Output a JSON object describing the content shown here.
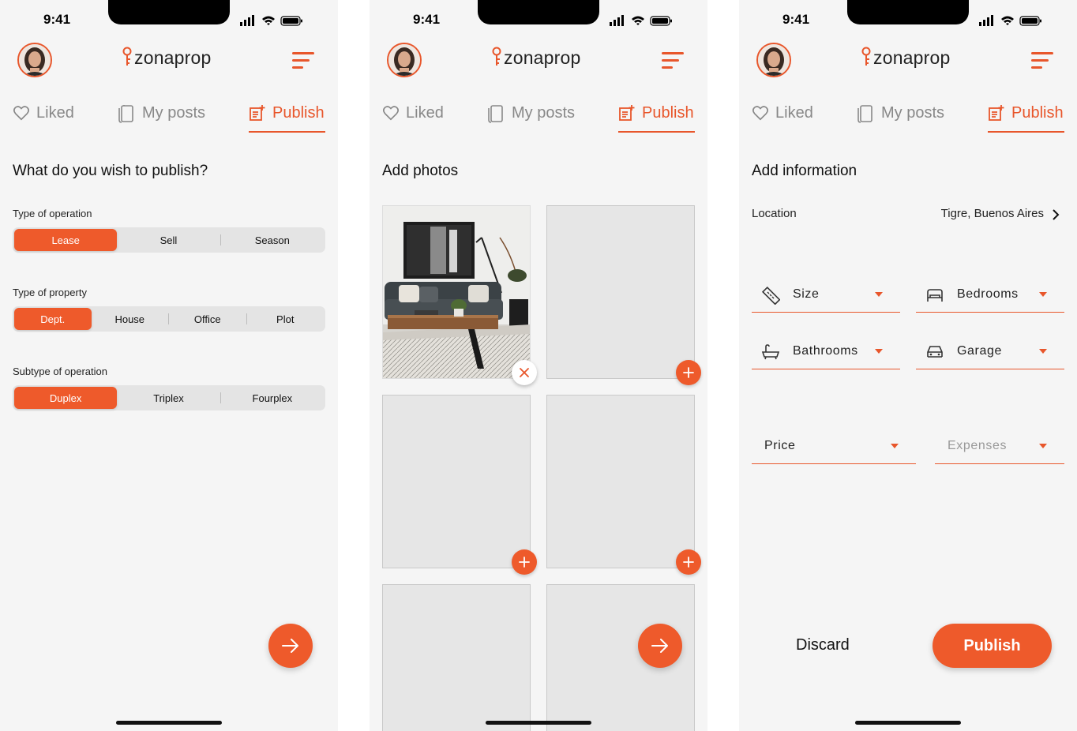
{
  "status": {
    "time": "9:41"
  },
  "app": {
    "brand": "zonaprop"
  },
  "tabs": {
    "liked": "Liked",
    "my_posts": "My posts",
    "publish": "Publish"
  },
  "colors": {
    "accent": "#ee5a2b",
    "background": "#f5f5f5",
    "segment_bg": "#e4e4e4"
  },
  "screen1": {
    "title": "What do you wish to publish?",
    "operation": {
      "label": "Type of operation",
      "options": [
        "Lease",
        "Sell",
        "Season"
      ],
      "selected": "Lease"
    },
    "property": {
      "label": "Type of property",
      "options": [
        "Dept.",
        "House",
        "Office",
        "Plot"
      ],
      "selected": "Dept."
    },
    "subtype": {
      "label": "Subtype of operation",
      "options": [
        "Duplex",
        "Triplex",
        "Fourplex"
      ],
      "selected": "Duplex"
    }
  },
  "screen2": {
    "title": "Add photos",
    "photo_slots": 6,
    "filled_slots": 1
  },
  "screen3": {
    "title": "Add information",
    "location": {
      "label": "Location",
      "value": "Tigre, Buenos Aires"
    },
    "fields": {
      "size": "Size",
      "bedrooms": "Bedrooms",
      "bathrooms": "Bathrooms",
      "garage": "Garage",
      "price": "Price",
      "expenses": "Expenses"
    },
    "discard": "Discard",
    "publish": "Publish"
  },
  "icons": [
    "heart-icon",
    "document-icon",
    "publish-icon",
    "menu-icon",
    "arrow-right-icon",
    "plus-icon",
    "close-icon",
    "ruler-icon",
    "bed-icon",
    "bathtub-icon",
    "car-icon",
    "chevron-right-icon"
  ]
}
